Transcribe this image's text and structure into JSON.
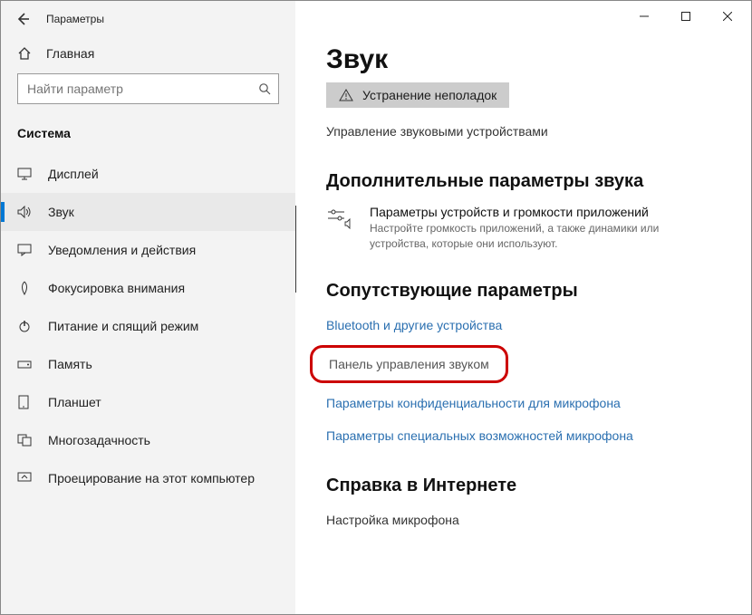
{
  "window": {
    "title": "Параметры"
  },
  "sidebar": {
    "home_label": "Главная",
    "search_placeholder": "Найти параметр",
    "category": "Система",
    "items": [
      {
        "icon": "display",
        "label": "Дисплей"
      },
      {
        "icon": "sound",
        "label": "Звук"
      },
      {
        "icon": "notify",
        "label": "Уведомления и действия"
      },
      {
        "icon": "focus",
        "label": "Фокусировка внимания"
      },
      {
        "icon": "power",
        "label": "Питание и спящий режим"
      },
      {
        "icon": "storage",
        "label": "Память"
      },
      {
        "icon": "tablet",
        "label": "Планшет"
      },
      {
        "icon": "multitask",
        "label": "Многозадачность"
      },
      {
        "icon": "project",
        "label": "Проецирование на этот компьютер"
      }
    ],
    "selected_index": 1
  },
  "main": {
    "heading": "Звук",
    "troubleshoot_label": "Устранение неполадок",
    "manage_devices_label": "Управление звуковыми устройствами",
    "advanced_title": "Дополнительные параметры звука",
    "app_volume_title": "Параметры устройств и громкости приложений",
    "app_volume_desc": "Настройте громкость приложений, а также динамики или устройства, которые они используют.",
    "related_title": "Сопутствующие параметры",
    "related_links": [
      "Bluetooth и другие устройства",
      "Панель управления звуком",
      "Параметры конфиденциальности для микрофона",
      "Параметры специальных возможностей микрофона"
    ],
    "help_title": "Справка в Интернете",
    "help_link": "Настройка микрофона"
  }
}
